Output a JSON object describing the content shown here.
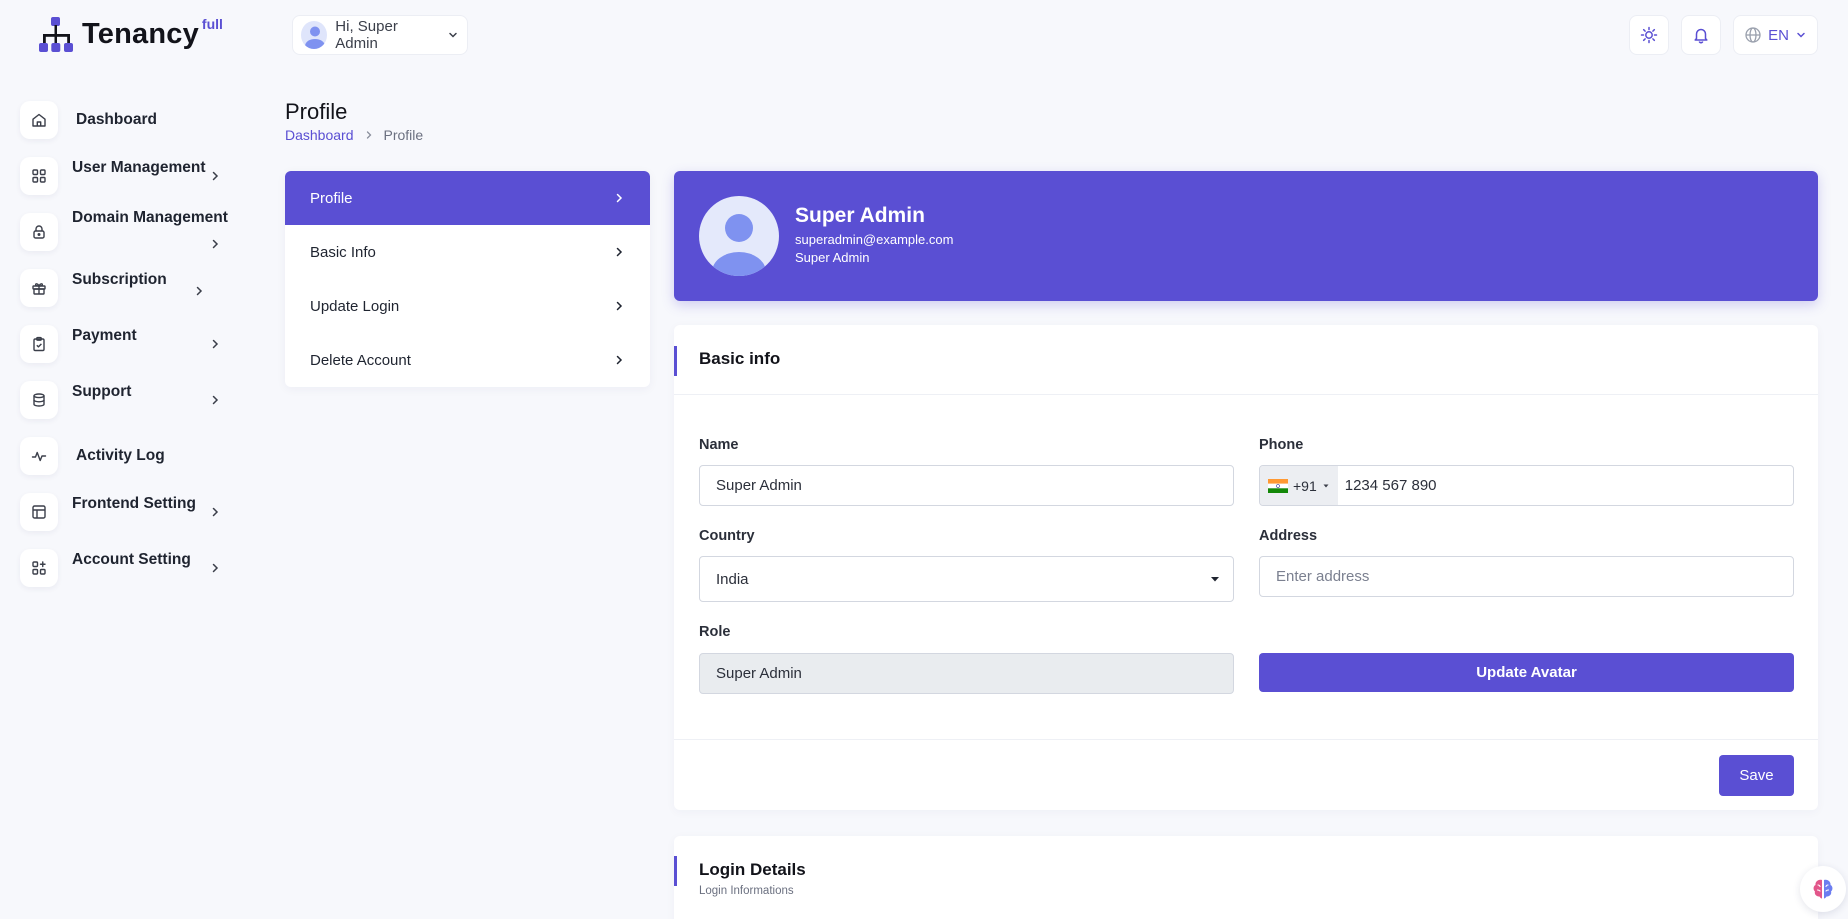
{
  "brand": {
    "name": "Tenancy",
    "sup": "full",
    "accent": "#5a4fd3"
  },
  "topbar": {
    "greeting": "Hi, Super Admin",
    "language": "EN",
    "icons": [
      "sun-icon",
      "bell-icon",
      "globe-icon"
    ]
  },
  "sidebar": {
    "items": [
      {
        "label": "Dashboard",
        "icon": "home-icon",
        "has_submenu": false
      },
      {
        "label": "User Management",
        "icon": "grid-icon",
        "has_submenu": true
      },
      {
        "label": "Domain Management",
        "icon": "lock-icon",
        "has_submenu": true
      },
      {
        "label": "Subscription",
        "icon": "gift-icon",
        "has_submenu": true
      },
      {
        "label": "Payment",
        "icon": "clipboard-icon",
        "has_submenu": true
      },
      {
        "label": "Support",
        "icon": "database-icon",
        "has_submenu": true
      },
      {
        "label": "Activity Log",
        "icon": "activity-icon",
        "has_submenu": false
      },
      {
        "label": "Frontend Setting",
        "icon": "layout-icon",
        "has_submenu": true
      },
      {
        "label": "Account Setting",
        "icon": "apps-add-icon",
        "has_submenu": true
      }
    ]
  },
  "page": {
    "title": "Profile",
    "breadcrumb": [
      "Dashboard",
      "Profile"
    ]
  },
  "profile_menu": {
    "items": [
      {
        "label": "Profile",
        "active": true
      },
      {
        "label": "Basic Info",
        "active": false
      },
      {
        "label": "Update Login",
        "active": false
      },
      {
        "label": "Delete Account",
        "active": false
      }
    ]
  },
  "profile_header": {
    "name": "Super Admin",
    "email": "superadmin@example.com",
    "role": "Super Admin"
  },
  "basic_info": {
    "title": "Basic info",
    "name_label": "Name",
    "name_value": "Super Admin",
    "phone_label": "Phone",
    "phone_dial_code": "+91",
    "phone_value": "1234 567 890",
    "country_label": "Country",
    "country_value": "India",
    "address_label": "Address",
    "address_placeholder": "Enter address",
    "role_label": "Role",
    "role_value": "Super Admin",
    "update_avatar_label": "Update Avatar",
    "save_label": "Save"
  },
  "login_details": {
    "title": "Login Details",
    "subtitle": "Login Informations"
  }
}
